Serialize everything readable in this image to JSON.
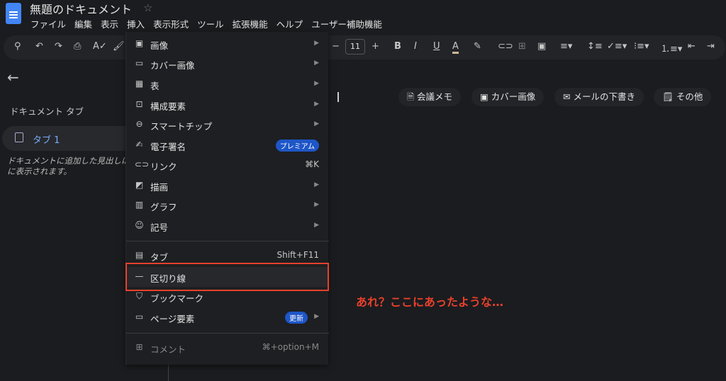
{
  "app": {
    "title": "無題のドキュメント"
  },
  "menubar": [
    "ファイル",
    "編集",
    "表示",
    "挿入",
    "表示形式",
    "ツール",
    "拡張機能",
    "ヘルプ",
    "ユーザー補助機能"
  ],
  "toolbar": {
    "font_size": "11",
    "icons": [
      "search-icon",
      "undo-icon",
      "redo-icon",
      "print-icon",
      "spellcheck-icon",
      "paint-format-icon",
      "minus-icon",
      "plus-icon",
      "bold-icon",
      "italic-icon",
      "underline-icon",
      "text-color-icon",
      "highlight-icon",
      "link-icon",
      "comment-icon",
      "image-icon",
      "align-icon",
      "line-spacing-icon",
      "checklist-icon",
      "bullet-list-icon",
      "numbered-list-icon",
      "indent-decrease-icon",
      "indent-increase-icon"
    ],
    "text_color_swatch": "#c8b89a"
  },
  "sidebar": {
    "title": "ドキュメント タブ",
    "tab": "タブ 1",
    "note": "ドキュメントに追加した見出しは\nに表示されます。"
  },
  "insert_menu": {
    "items": [
      {
        "label": "画像",
        "icon": "image-icon",
        "submenu": true
      },
      {
        "label": "カバー画像",
        "icon": "cover-image-icon",
        "submenu": true
      },
      {
        "label": "表",
        "icon": "table-icon",
        "submenu": true
      },
      {
        "label": "構成要素",
        "icon": "building-blocks-icon",
        "submenu": true
      },
      {
        "label": "スマートチップ",
        "icon": "smart-chip-icon",
        "submenu": true
      },
      {
        "label": "電子署名",
        "icon": "signature-icon",
        "badge": "プレミアム"
      },
      {
        "label": "リンク",
        "icon": "link-icon",
        "shortcut": "⌘K"
      },
      {
        "label": "描画",
        "icon": "drawing-icon",
        "submenu": true
      },
      {
        "label": "グラフ",
        "icon": "chart-icon",
        "submenu": true
      },
      {
        "label": "記号",
        "icon": "emoji-icon",
        "submenu": true
      },
      {
        "label": "タブ",
        "icon": "tab-icon",
        "shortcut": "Shift+F11"
      },
      {
        "label": "区切り線",
        "icon": "horizontal-line-icon"
      },
      {
        "label": "ブックマーク",
        "icon": "bookmark-icon"
      },
      {
        "label": "ページ要素",
        "icon": "page-elements-icon",
        "badge": "更新",
        "submenu": true
      },
      {
        "label": "コメント",
        "icon": "comment-icon",
        "shortcut": "⌘+option+M",
        "disabled": true
      }
    ]
  },
  "chips": [
    "会議メモ",
    "カバー画像",
    "メールの下書き",
    "その他"
  ],
  "annotation": "あれ？ここにあったような…",
  "colors": {
    "highlight_box": "#e8412c",
    "badge": "#1e56c8",
    "accent": "#7cacf8"
  }
}
